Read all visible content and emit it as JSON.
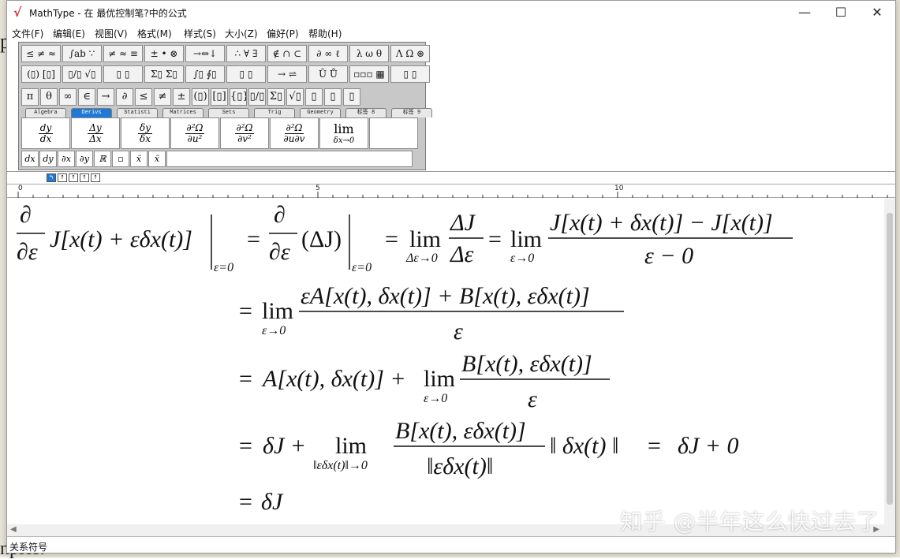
{
  "window": {
    "title": "MathType - 在 最优控制笔?中的公式",
    "min_glyph": "—",
    "max_glyph": "☐",
    "close_glyph": "✕",
    "logo_glyph": "√"
  },
  "menu": [
    "文件(F)",
    "编辑(E)",
    "视图(V)",
    "格式(M)",
    "样式(S)",
    "大小(Z)",
    "偏好(P)",
    "帮助(H)"
  ],
  "toolbar": {
    "row1": [
      "≤ ≠ ≈",
      "∫ab ∵",
      "≠ ≈ ≡",
      "± • ⊗",
      "→⇔↓",
      "∴ ∀ ∃",
      "∉ ∩ ⊂",
      "∂ ∞ ℓ",
      "λ ω θ",
      "Λ Ω ⊛"
    ],
    "row2": [
      "(▯) [▯]",
      "▯/▯ √▯",
      "▯ ▯",
      "Σ▯ Σ▯",
      "∫▯ ∮▯",
      "▯ ▯",
      "→ ⇌",
      "Ū Ů",
      "▫▫▫ ▦",
      "▯ ▯"
    ],
    "row3": [
      "π",
      "θ",
      "∞",
      "∈",
      "→",
      "∂",
      "≤",
      "≠",
      "±",
      "(▯)",
      "[▯]",
      "{▯}",
      "▯/▯",
      "Σ▯",
      "√▯",
      "▯",
      "▯",
      "▯"
    ],
    "tabs": [
      "Algebra",
      "Derivs",
      "Statisti",
      "Matrices",
      "Sets",
      "Trig",
      "Geometry",
      "标签 8",
      "标签 9"
    ],
    "active_tab": "Derivs",
    "derivs": [
      {
        "num": "dy",
        "den": "dx"
      },
      {
        "num": "Δy",
        "den": "Δx"
      },
      {
        "num": "δy",
        "den": "δx"
      },
      {
        "num": "∂²Ω",
        "den": "∂u²"
      },
      {
        "num": "∂²Ω",
        "den": "∂v²"
      },
      {
        "num": "∂²Ω",
        "den": "∂u∂v"
      }
    ],
    "lim": {
      "main": "lim",
      "sub": "δx→0"
    },
    "small": [
      "dx",
      "dy",
      "∂x",
      "∂y",
      "ℝ",
      "▫",
      "ẍ",
      "ẍ"
    ]
  },
  "mini_bar": [
    "↰",
    "↑",
    "↑",
    "↑",
    "↑"
  ],
  "ruler": {
    "marks": [
      "0",
      "5",
      "10"
    ]
  },
  "status": "关系符号",
  "watermark": "知乎 @半年这么快过去了",
  "background": {
    "top": "p",
    "bottom": "nples."
  },
  "equations": {
    "line1": {
      "d_num": "∂",
      "d_den": "∂ε",
      "lhs": "J[x(t) + εδx(t)]",
      "eval1": "ε=0",
      "eq": "=",
      "d2_num": "∂",
      "d2_den": "∂ε",
      "paren": "(ΔJ)",
      "eval2": "ε=0",
      "lim": "lim",
      "lim_sub": "Δε→0",
      "f1_num": "ΔJ",
      "f1_den": "Δε",
      "lim2": "lim",
      "lim2_sub": "ε→0",
      "f2_num": "J[x(t) + δx(t)] − J[x(t)]",
      "f2_den": "ε − 0"
    },
    "line2": {
      "eq": "=",
      "lim": "lim",
      "lim_sub": "ε→0",
      "num": "εA[x(t), δx(t)] + B[x(t), εδx(t)]",
      "den": "ε"
    },
    "line3": {
      "eq": "=",
      "lead": "A[x(t), δx(t)] +",
      "lim": "lim",
      "lim_sub": "ε→0",
      "num": "B[x(t), εδx(t)]",
      "den": "ε"
    },
    "line4": {
      "eq": "=",
      "lead": "δJ +",
      "lim": "lim",
      "lim_sub": "‖εδx(t)‖→0",
      "num": "B[x(t), εδx(t)]",
      "den": "‖εδx(t)‖",
      "tail": "‖ δx(t) ‖",
      "eq2": "=",
      "result": "δJ + 0"
    },
    "line5": {
      "eq": "=",
      "result": "δJ"
    }
  }
}
